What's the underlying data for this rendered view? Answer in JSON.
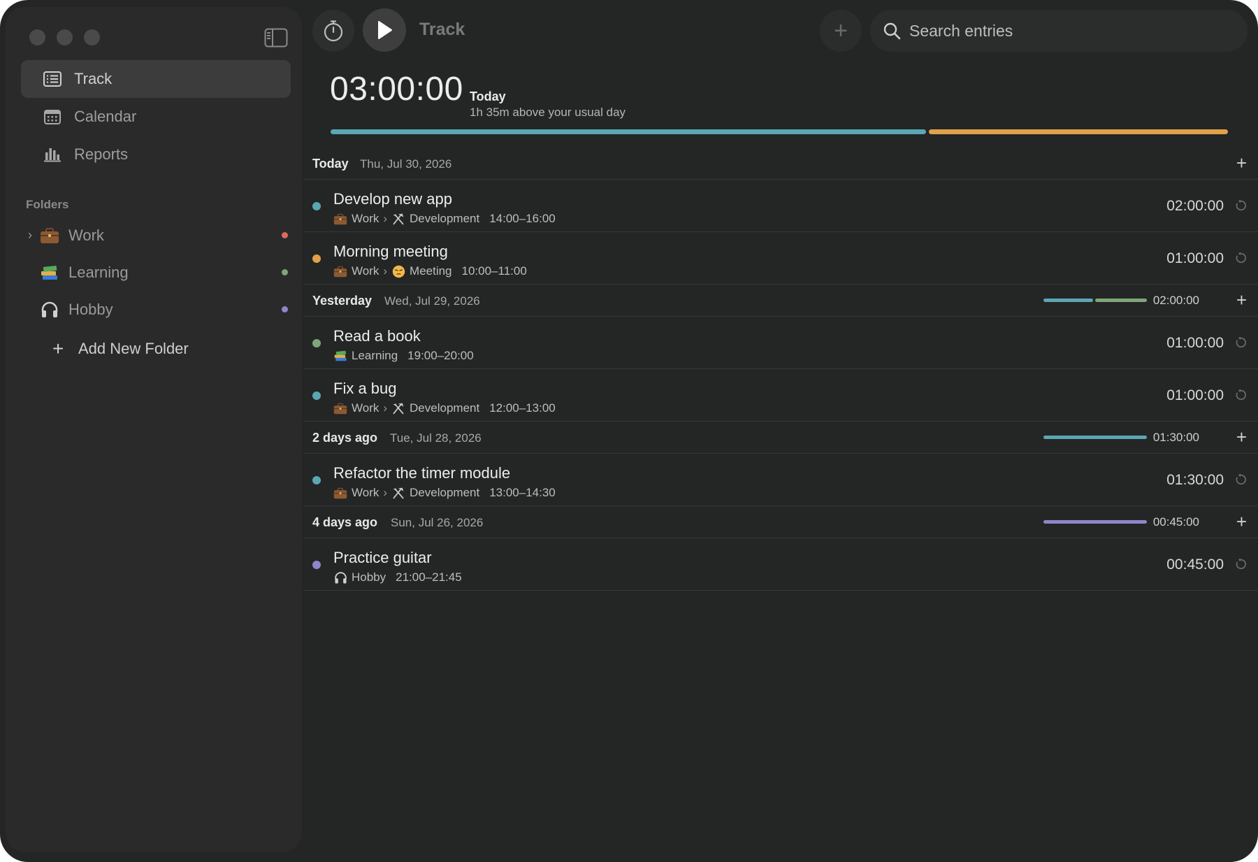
{
  "toolbar": {
    "title": "Track",
    "search_placeholder": "Search entries"
  },
  "sidebar": {
    "nav": [
      {
        "label": "Track",
        "icon": "list-icon",
        "active": true
      },
      {
        "label": "Calendar",
        "icon": "calendar-icon",
        "active": false
      },
      {
        "label": "Reports",
        "icon": "bar-chart-icon",
        "active": false
      }
    ],
    "folders_label": "Folders",
    "folders": [
      {
        "label": "Work",
        "icon": "briefcase-icon",
        "color": "#d96c5c",
        "expandable": true
      },
      {
        "label": "Learning",
        "icon": "books-icon",
        "color": "#7fa67a",
        "expandable": false
      },
      {
        "label": "Hobby",
        "icon": "headphones-icon",
        "color": "#8f86c9",
        "expandable": false
      }
    ],
    "add_folder_label": "Add New Folder"
  },
  "summary": {
    "total": "03:00:00",
    "day": "Today",
    "subtitle": "1h 35m above your usual day",
    "segments": [
      {
        "color": "#5aa7b3",
        "fraction": 0.667
      },
      {
        "color": "#e1a04a",
        "fraction": 0.333
      }
    ]
  },
  "colors": {
    "development": "#5aa7b3",
    "meeting": "#e1a04a",
    "learning": "#7fa67a",
    "hobby": "#8f86c9"
  },
  "days": [
    {
      "label": "Today",
      "date": "Thu, Jul 30, 2026",
      "total": "",
      "entries": [
        {
          "title": "Develop new app",
          "folder": "Work",
          "sub": "Development",
          "range": "14:00–16:00",
          "duration": "02:00:00"
        },
        {
          "title": "Morning meeting",
          "folder": "Work",
          "sub": "Meeting",
          "range": "10:00–11:00",
          "duration": "01:00:00"
        }
      ]
    },
    {
      "label": "Yesterday",
      "date": "Wed, Jul 29, 2026",
      "total": "02:00:00",
      "entries": [
        {
          "title": "Read a book",
          "folder": "Learning",
          "range": "19:00–20:00",
          "duration": "01:00:00"
        },
        {
          "title": "Fix a bug",
          "folder": "Work",
          "sub": "Development",
          "range": "12:00–13:00",
          "duration": "01:00:00"
        }
      ]
    },
    {
      "label": "2 days ago",
      "date": "Tue, Jul 28, 2026",
      "total": "01:30:00",
      "entries": [
        {
          "title": "Refactor the timer module",
          "folder": "Work",
          "sub": "Development",
          "range": "13:00–14:30",
          "duration": "01:30:00"
        }
      ]
    },
    {
      "label": "4 days ago",
      "date": "Sun, Jul 26, 2026",
      "total": "00:45:00",
      "entries": [
        {
          "title": "Practice guitar",
          "folder": "Hobby",
          "range": "21:00–21:45",
          "duration": "00:45:00"
        }
      ]
    }
  ]
}
